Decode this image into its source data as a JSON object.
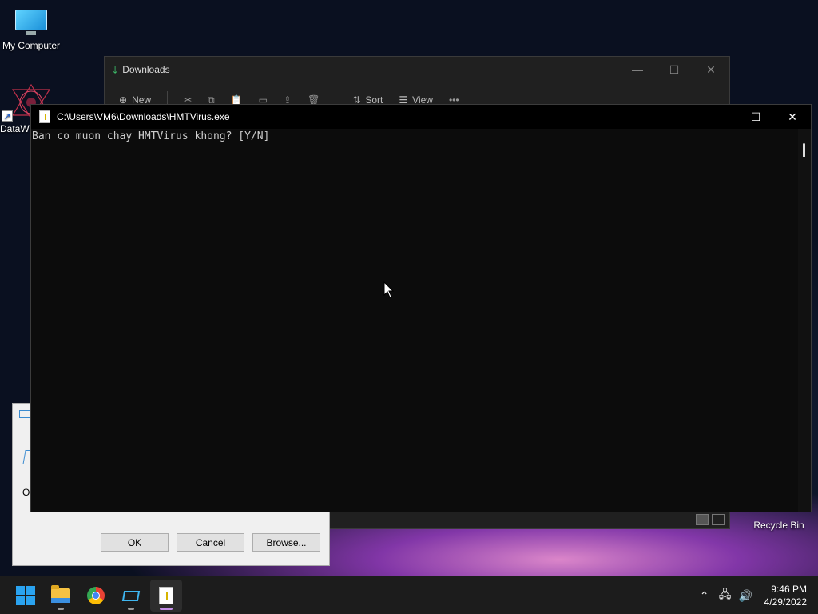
{
  "desktop": {
    "icons": [
      {
        "label": "My Computer"
      },
      {
        "label": "DataW"
      },
      {
        "label": "Recycle Bin"
      }
    ]
  },
  "explorer": {
    "title": "Downloads",
    "toolbar": {
      "new_label": "New",
      "sort_label": "Sort",
      "view_label": "View",
      "more_label": "•••"
    }
  },
  "run_dialog": {
    "open_label": "O",
    "ok_label": "OK",
    "cancel_label": "Cancel",
    "browse_label": "Browse..."
  },
  "console": {
    "title": "C:\\Users\\VM6\\Downloads\\HMTVirus.exe",
    "output": "Ban co muon chay HMTVirus khong? [Y/N]"
  },
  "taskbar": {
    "apps": [
      "start-icon",
      "file-explorer-icon",
      "chrome-icon",
      "run-icon",
      "hmtvirus-exe-icon"
    ],
    "clock_time": "9:46 PM",
    "clock_date": "4/29/2022"
  },
  "colors": {
    "console_bg": "#0c0c0c",
    "console_text": "#cccccc",
    "taskbar_bg": "#1c1c1c",
    "active_indicator": "#c48ee8"
  }
}
